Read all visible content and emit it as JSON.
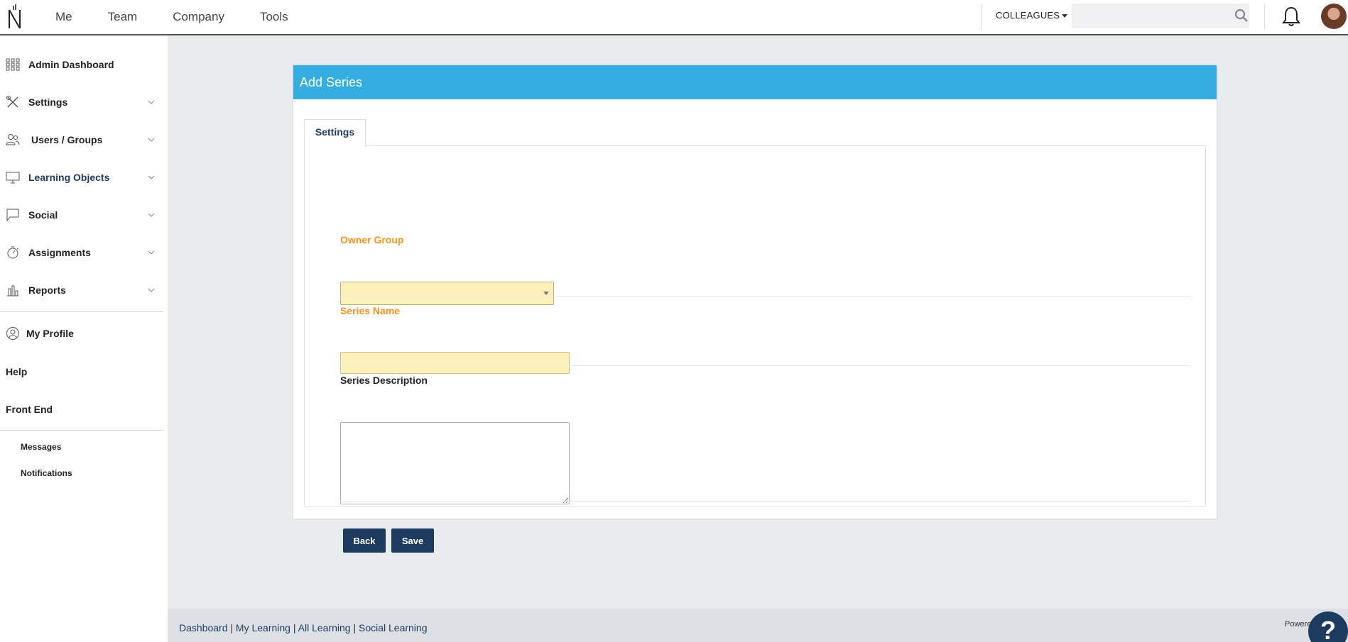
{
  "topbar": {
    "nav": [
      "Me",
      "Team",
      "Company",
      "Tools"
    ],
    "colleagues_label": "COLLEAGUES",
    "search_placeholder": ""
  },
  "sidebar": {
    "items": [
      {
        "label": "Admin Dashboard",
        "icon": "grid-icon"
      },
      {
        "label": "Settings",
        "icon": "tools-icon"
      },
      {
        "label": "Users / Groups",
        "icon": "users-icon"
      },
      {
        "label": "Learning Objects",
        "icon": "monitor-icon"
      },
      {
        "label": "Social",
        "icon": "chat-icon"
      },
      {
        "label": "Assignments",
        "icon": "stopwatch-icon"
      },
      {
        "label": "Reports",
        "icon": "bar-chart-icon"
      }
    ],
    "my_profile": "My Profile",
    "help": "Help",
    "front_end": "Front End",
    "messages": "Messages",
    "notifications": "Notifications"
  },
  "panel": {
    "title": "Add Series",
    "tab": "Settings",
    "owner_group_label": "Owner Group",
    "owner_group_value": "",
    "series_name_label": "Series Name",
    "series_name_value": "",
    "series_description_label": "Series Description",
    "series_description_value": "",
    "back_label": "Back",
    "save_label": "Save"
  },
  "footer": {
    "links": [
      "Dashboard",
      "My Learning",
      "All Learning",
      "Social Learning"
    ],
    "powered": "Powere"
  },
  "help_button": "?",
  "colors": {
    "header_blue": "#35ade1",
    "primary_navy": "#1d3a5f",
    "required_orange": "#f7941d",
    "required_field_bg": "#fdf0b8"
  }
}
